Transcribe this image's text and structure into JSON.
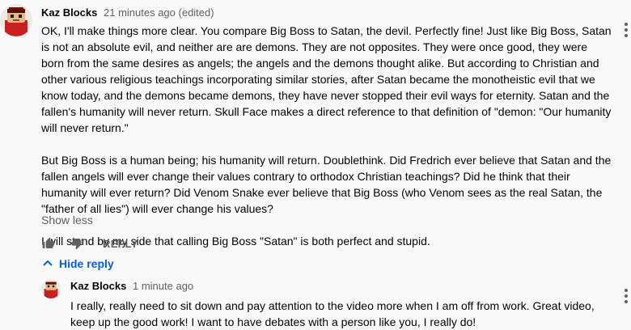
{
  "main_comment": {
    "author": "Kaz Blocks",
    "time": "21 minutes ago (edited)",
    "paragraphs": [
      "OK, I'll make things more clear. You compare Big Boss to Satan, the devil. Perfectly fine! Just like Big Boss, Satan is not an absolute evil, and neither are are demons. They are not opposites. They were once good, they were born from the same desires as angels; the angels and the demons thought alike. But according to Christian and other various religious teachings incorporating similar stories, after Satan became the monotheistic evil that we know today, and the demons became demons, they have never stopped their evil ways for eternity. Satan and the fallen's humanity will never return. Skull Face makes a direct reference to that definition of \"demon: \"Our humanity will never return.\"",
      "But Big Boss is a human being; his humanity will return. Doublethink. Did Fredrich ever believe that Satan and the fallen angels will ever change their values contrary to orthodox Christian teachings? Did he think that their humanity will ever return? Did Venom Snake ever believe that Big Boss (who Venom sees as the real Satan, the \"father of all lies\") will ever change his values?",
      "I will stand by my side that calling Big Boss \"Satan\" is both perfect and stupid."
    ],
    "show_less": "Show less",
    "reply_label": "REPLY",
    "hide_reply": "Hide reply"
  },
  "reply_comment": {
    "author": "Kaz Blocks",
    "time": "1 minute ago",
    "text": "I really, really need to sit down and pay attention to the video more when I am off from work. Great video, keep up the good work! I want to have debates with a person like you, I really do!"
  },
  "icons": {
    "like": "thumbs-up-icon",
    "dislike": "thumbs-down-icon",
    "chevron": "chevron-up-icon",
    "menu": "more-vert-icon"
  },
  "colors": {
    "link_blue": "#065fd4",
    "secondary_text": "#606060",
    "avatar_red": "#c8201e"
  }
}
